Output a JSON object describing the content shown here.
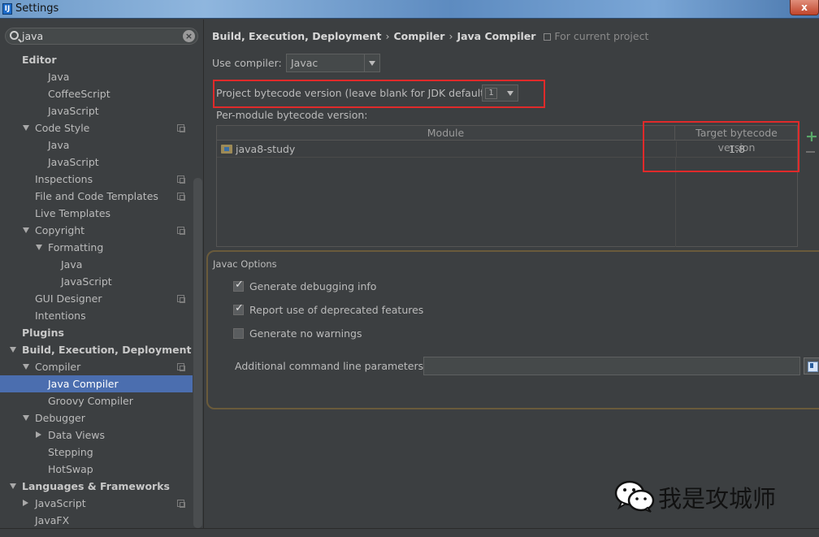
{
  "window": {
    "title": "Settings",
    "app_icon": "intellij-app-icon",
    "close_label": "x"
  },
  "search": {
    "value": "java",
    "icon": "search-icon",
    "clear_icon": "clear-icon"
  },
  "tree": [
    {
      "label": "Editor",
      "indent": 0,
      "bold": true
    },
    {
      "label": "Java",
      "indent": 2
    },
    {
      "label": "CoffeeScript",
      "indent": 2
    },
    {
      "label": "JavaScript",
      "indent": 2
    },
    {
      "label": "Code Style",
      "indent": 1,
      "arrow": "down",
      "copy": true
    },
    {
      "label": "Java",
      "indent": 2
    },
    {
      "label": "JavaScript",
      "indent": 2
    },
    {
      "label": "Inspections",
      "indent": 1,
      "copy": true
    },
    {
      "label": "File and Code Templates",
      "indent": 1,
      "copy": true
    },
    {
      "label": "Live Templates",
      "indent": 1
    },
    {
      "label": "Copyright",
      "indent": 1,
      "arrow": "down",
      "copy": true
    },
    {
      "label": "Formatting",
      "indent": 2,
      "arrow": "down"
    },
    {
      "label": "Java",
      "indent": 3
    },
    {
      "label": "JavaScript",
      "indent": 3
    },
    {
      "label": "GUI Designer",
      "indent": 1,
      "copy": true
    },
    {
      "label": "Intentions",
      "indent": 1
    },
    {
      "label": "Plugins",
      "indent": 0,
      "bold": true
    },
    {
      "label": "Build, Execution, Deployment",
      "indent": 0,
      "bold": true,
      "arrow": "down"
    },
    {
      "label": "Compiler",
      "indent": 1,
      "arrow": "down",
      "copy": true
    },
    {
      "label": "Java Compiler",
      "indent": 2,
      "selected": true
    },
    {
      "label": "Groovy Compiler",
      "indent": 2
    },
    {
      "label": "Debugger",
      "indent": 1,
      "arrow": "down"
    },
    {
      "label": "Data Views",
      "indent": 2,
      "arrow": "right"
    },
    {
      "label": "Stepping",
      "indent": 2
    },
    {
      "label": "HotSwap",
      "indent": 2
    },
    {
      "label": "Languages & Frameworks",
      "indent": 0,
      "bold": true,
      "arrow": "down"
    },
    {
      "label": "JavaScript",
      "indent": 1,
      "arrow": "right",
      "copy": true
    },
    {
      "label": "JavaFX",
      "indent": 1
    }
  ],
  "breadcrumb": {
    "items": [
      "Build, Execution, Deployment",
      "Compiler",
      "Java Compiler"
    ],
    "separator": "›",
    "scope": "For current project"
  },
  "compiler": {
    "use_compiler_label": "Use compiler:",
    "use_compiler_value": "Javac",
    "bytecode_label": "Project bytecode version (leave blank for JDK default):",
    "bytecode_value": "1",
    "per_module_label": "Per-module bytecode version:"
  },
  "module_table": {
    "columns": [
      "Module",
      "Target bytecode version"
    ],
    "rows": [
      {
        "module": "java8-study",
        "target": "1.8"
      }
    ]
  },
  "javac_options": {
    "title": "Javac Options",
    "options": [
      {
        "label": "Generate debugging info",
        "checked": true
      },
      {
        "label": "Report use of deprecated features",
        "checked": true
      },
      {
        "label": "Generate no warnings",
        "checked": false
      }
    ],
    "params_label": "Additional command line parameters:",
    "params_value": ""
  },
  "watermark": {
    "text": "我是攻城师",
    "icon": "wechat-icon"
  },
  "colors": {
    "selection": "#4b6eaf",
    "highlight_box": "#e02a2a",
    "add": "#59a869",
    "background": "#3c3f41"
  }
}
